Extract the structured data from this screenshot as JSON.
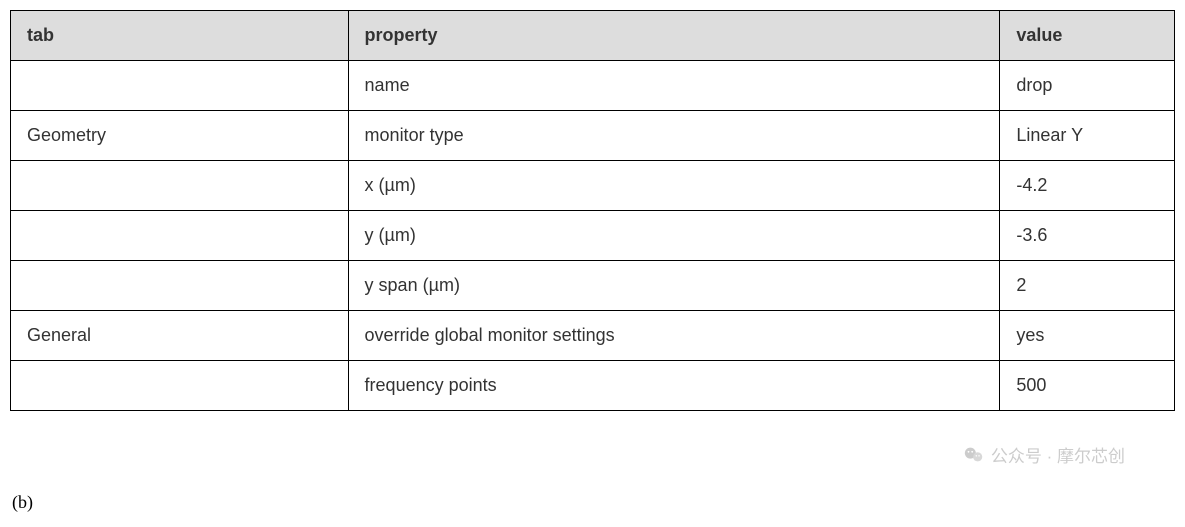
{
  "table": {
    "headers": [
      "tab",
      "property",
      "value"
    ],
    "rows": [
      {
        "tab": "",
        "property": "name",
        "value": "drop"
      },
      {
        "tab": "Geometry",
        "property": "monitor type",
        "value": "Linear Y"
      },
      {
        "tab": "",
        "property": "x (µm)",
        "value": "-4.2"
      },
      {
        "tab": "",
        "property": "y  (µm)",
        "value": "-3.6"
      },
      {
        "tab": "",
        "property": "y span (µm)",
        "value": "2"
      },
      {
        "tab": "General",
        "property": "override global monitor settings",
        "value": "yes"
      },
      {
        "tab": "",
        "property": "frequency points",
        "value": "500"
      }
    ]
  },
  "caption": "(b)",
  "watermark": {
    "icon_name": "wechat-icon",
    "text": "公众号 · 摩尔芯创"
  }
}
